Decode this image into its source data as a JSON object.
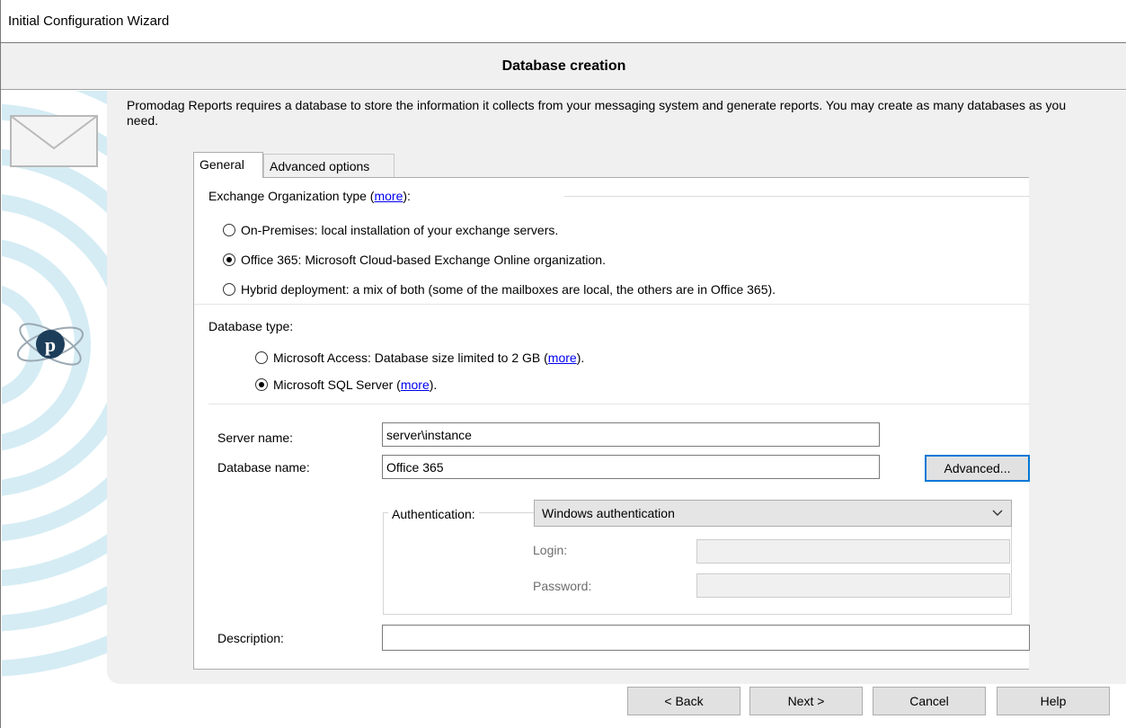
{
  "window": {
    "title": "Initial Configuration Wizard"
  },
  "header": {
    "title": "Database creation"
  },
  "intro": {
    "text": "Promodag Reports requires a database to store the information it collects from your messaging system and generate reports. You may create as many databases as you need."
  },
  "tabs": [
    {
      "label": "General",
      "active": true
    },
    {
      "label": "Advanced options",
      "active": false
    }
  ],
  "exchange": {
    "label_prefix": "Exchange Organization type (",
    "more": "more",
    "label_suffix": "):",
    "options": [
      {
        "label": "On-Premises: local installation of your exchange servers.",
        "checked": false
      },
      {
        "label": "Office 365: Microsoft Cloud-based Exchange Online organization.",
        "checked": true
      },
      {
        "label": "Hybrid deployment: a mix of both (some of the mailboxes are local, the others are in Office 365).",
        "checked": false
      }
    ]
  },
  "database_type": {
    "label": "Database type:",
    "access": {
      "label": "Microsoft Access: Database size limited to 2 GB (",
      "more": "more",
      "suffix": ").",
      "checked": false
    },
    "sql": {
      "label": "Microsoft SQL Server (",
      "more": "more",
      "suffix": ").",
      "checked": true
    }
  },
  "form": {
    "server_label": "Server name:",
    "server_value": "server\\instance",
    "database_label": "Database name:",
    "database_value": "Office 365",
    "advanced_button": "Advanced...",
    "auth_label": "Authentication:",
    "auth_value": "Windows authentication",
    "login_label": "Login:",
    "login_value": "",
    "password_label": "Password:",
    "password_value": "",
    "description_label": "Description:",
    "description_value": ""
  },
  "buttons": {
    "back": "< Back",
    "next": "Next >",
    "cancel": "Cancel",
    "help": "Help"
  },
  "icons": {
    "left_art": [
      "envelope-icon",
      "promodag-logo-icon"
    ],
    "dropdown": "chevron-down-icon"
  }
}
